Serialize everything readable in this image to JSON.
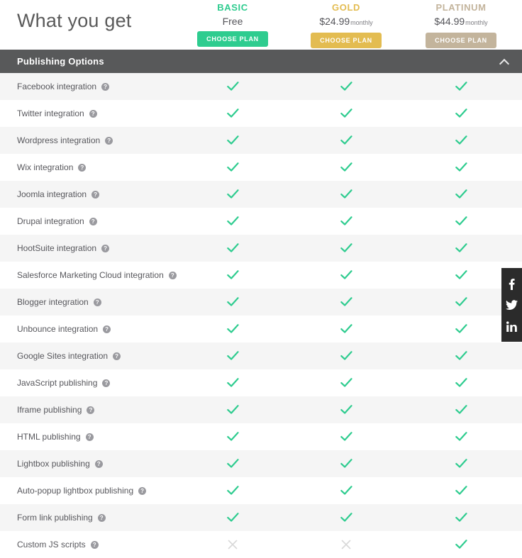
{
  "header": {
    "title": "What you get",
    "plans": [
      {
        "name": "BASIC",
        "price": "Free",
        "period": "",
        "button_label": "CHOOSE PLAN",
        "accent_color": "#2ecc8f"
      },
      {
        "name": "GOLD",
        "price": "$24.99",
        "period": "monthly",
        "button_label": "CHOOSE PLAN",
        "accent_color": "#e3bc51"
      },
      {
        "name": "PLATINUM",
        "price": "$44.99",
        "period": "monthly",
        "button_label": "CHOOSE PLAN",
        "accent_color": "#c3b49c"
      }
    ]
  },
  "section": {
    "title": "Publishing Options",
    "collapse_icon": "chevron-up-icon",
    "background_color": "#58595a"
  },
  "help_icon_glyph": "?",
  "marks": {
    "check_color": "#2ecc8f",
    "cross_color": "#d8d8d8"
  },
  "features": [
    {
      "label": "Facebook integration",
      "help": "?",
      "basic": "check",
      "gold": "check",
      "platinum": "check"
    },
    {
      "label": "Twitter integration",
      "help": "?",
      "basic": "check",
      "gold": "check",
      "platinum": "check"
    },
    {
      "label": "Wordpress integration",
      "help": "?",
      "basic": "check",
      "gold": "check",
      "platinum": "check"
    },
    {
      "label": "Wix integration",
      "help": "?",
      "basic": "check",
      "gold": "check",
      "platinum": "check"
    },
    {
      "label": "Joomla integration",
      "help": "?",
      "basic": "check",
      "gold": "check",
      "platinum": "check"
    },
    {
      "label": "Drupal integration",
      "help": "?",
      "basic": "check",
      "gold": "check",
      "platinum": "check"
    },
    {
      "label": "HootSuite integration",
      "help": "?",
      "basic": "check",
      "gold": "check",
      "platinum": "check"
    },
    {
      "label": "Salesforce Marketing Cloud integration",
      "help": "?",
      "basic": "check",
      "gold": "check",
      "platinum": "check"
    },
    {
      "label": "Blogger integration",
      "help": "?",
      "basic": "check",
      "gold": "check",
      "platinum": "check"
    },
    {
      "label": "Unbounce integration",
      "help": "?",
      "basic": "check",
      "gold": "check",
      "platinum": "check"
    },
    {
      "label": "Google Sites integration",
      "help": "?",
      "basic": "check",
      "gold": "check",
      "platinum": "check"
    },
    {
      "label": "JavaScript publishing",
      "help": "?",
      "basic": "check",
      "gold": "check",
      "platinum": "check"
    },
    {
      "label": "Iframe publishing",
      "help": "?",
      "basic": "check",
      "gold": "check",
      "platinum": "check"
    },
    {
      "label": "HTML publishing",
      "help": "?",
      "basic": "check",
      "gold": "check",
      "platinum": "check"
    },
    {
      "label": "Lightbox publishing",
      "help": "?",
      "basic": "check",
      "gold": "check",
      "platinum": "check"
    },
    {
      "label": "Auto-popup lightbox publishing",
      "help": "?",
      "basic": "check",
      "gold": "check",
      "platinum": "check"
    },
    {
      "label": "Form link publishing",
      "help": "?",
      "basic": "check",
      "gold": "check",
      "platinum": "check"
    },
    {
      "label": "Custom JS scripts",
      "help": "?",
      "basic": "cross",
      "gold": "cross",
      "platinum": "check"
    }
  ],
  "social_sidebar": {
    "background_color": "#2b2b2b",
    "items": [
      {
        "icon": "facebook-icon",
        "label": "Facebook"
      },
      {
        "icon": "twitter-icon",
        "label": "Twitter"
      },
      {
        "icon": "linkedin-icon",
        "label": "LinkedIn"
      }
    ]
  }
}
